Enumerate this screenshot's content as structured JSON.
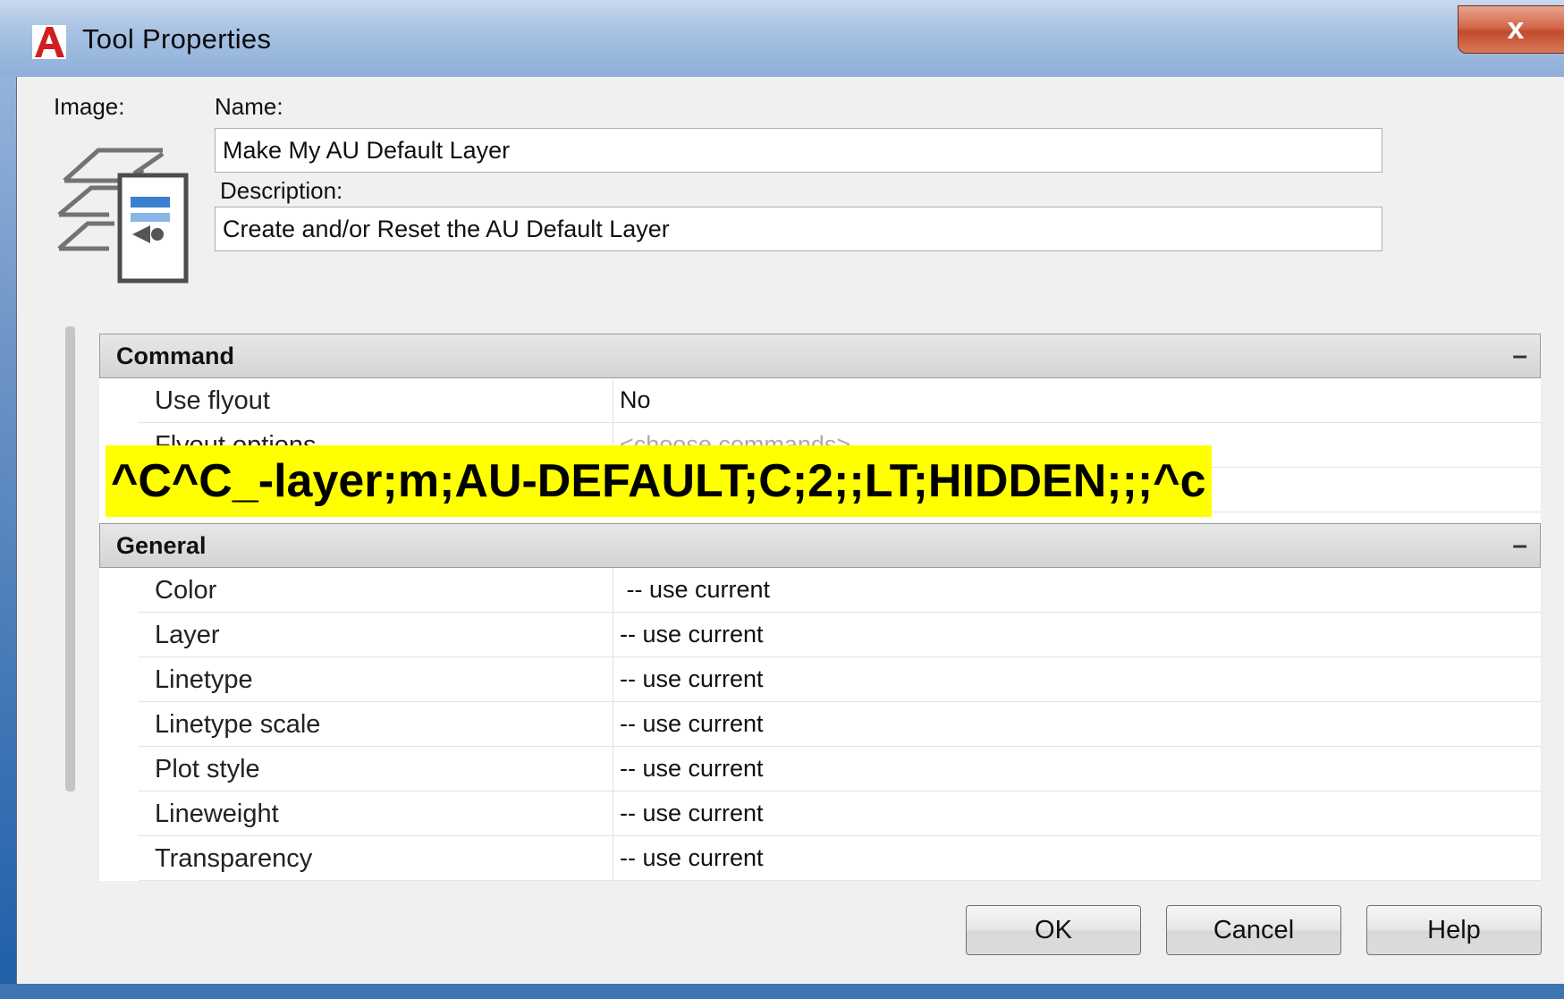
{
  "window": {
    "title": "Tool Properties",
    "close_glyph": "x",
    "app_icon": "autocad-a-icon"
  },
  "fields": {
    "image_label": "Image:",
    "name_label": "Name:",
    "name_value": "Make My AU Default Layer",
    "description_label": "Description:",
    "description_value": "Create and/or Reset the AU Default Layer"
  },
  "grid": {
    "categories": [
      {
        "label": "Command",
        "collapse_glyph": "–",
        "rows": [
          {
            "name": "Use flyout",
            "value": "No"
          },
          {
            "name": "Flyout options",
            "value": "<choose commands>"
          },
          {
            "name": "",
            "value": ""
          }
        ]
      },
      {
        "label": "General",
        "collapse_glyph": "–",
        "rows": [
          {
            "name": "Color",
            "value": " -- use current"
          },
          {
            "name": "Layer",
            "value": "-- use current"
          },
          {
            "name": "Linetype",
            "value": "-- use current"
          },
          {
            "name": "Linetype scale",
            "value": "-- use current"
          },
          {
            "name": "Plot style",
            "value": "-- use current"
          },
          {
            "name": "Lineweight",
            "value": "-- use current"
          },
          {
            "name": "Transparency",
            "value": "-- use current"
          }
        ]
      }
    ]
  },
  "overlay": {
    "text": "^C^C_-layer;m;AU-DEFAULT;C;2;;LT;HIDDEN;;;^c",
    "highlight_color": "#ffff00"
  },
  "buttons": {
    "ok": "OK",
    "cancel": "Cancel",
    "help": "Help"
  }
}
